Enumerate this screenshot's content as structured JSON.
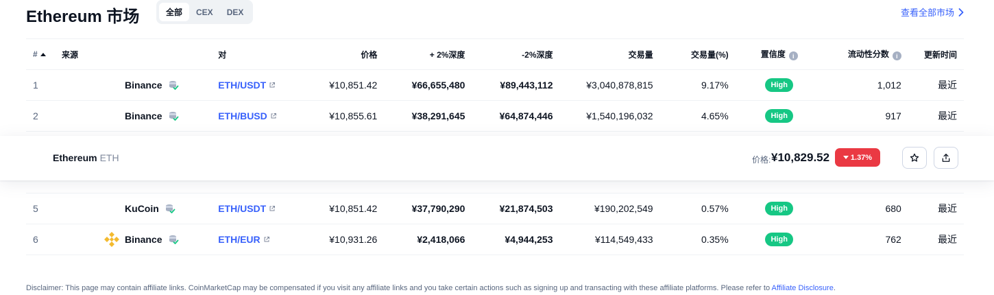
{
  "header": {
    "title": "Ethereum 市场",
    "filters": [
      "全部",
      "CEX",
      "DEX"
    ],
    "view_all": "查看全部市场"
  },
  "table": {
    "columns": {
      "rank": "#",
      "source": "来源",
      "pair": "对",
      "price": "价格",
      "plus_depth": "+ 2%深度",
      "minus_depth": "-2%深度",
      "volume": "交易量",
      "volume_pct": "交易量(%)",
      "confidence": "置信度",
      "liquidity": "流动性分数",
      "updated": "更新时间"
    },
    "rows": [
      {
        "rank": "1",
        "source": "Binance",
        "pair": "ETH/USDT",
        "price": "¥10,851.42",
        "plus_depth": "¥66,655,480",
        "minus_depth": "¥89,443,112",
        "volume": "¥3,040,878,815",
        "volume_pct": "9.17%",
        "confidence": "High",
        "liquidity": "1,012",
        "updated": "最近",
        "logo": "none"
      },
      {
        "rank": "2",
        "source": "Binance",
        "pair": "ETH/BUSD",
        "price": "¥10,855.61",
        "plus_depth": "¥38,291,645",
        "minus_depth": "¥64,874,446",
        "volume": "¥1,540,196,032",
        "volume_pct": "4.65%",
        "confidence": "High",
        "liquidity": "917",
        "updated": "最近",
        "logo": "none"
      },
      {
        "rank": "5",
        "source": "KuCoin",
        "pair": "ETH/USDT",
        "price": "¥10,851.42",
        "plus_depth": "¥37,790,290",
        "minus_depth": "¥21,874,503",
        "volume": "¥190,202,549",
        "volume_pct": "0.57%",
        "confidence": "High",
        "liquidity": "680",
        "updated": "最近",
        "logo": "none"
      },
      {
        "rank": "6",
        "source": "Binance",
        "pair": "ETH/EUR",
        "price": "¥10,931.26",
        "plus_depth": "¥2,418,066",
        "minus_depth": "¥4,944,253",
        "volume": "¥114,549,433",
        "volume_pct": "0.35%",
        "confidence": "High",
        "liquidity": "762",
        "updated": "最近",
        "logo": "binance-logo-icon"
      }
    ]
  },
  "sticky": {
    "name": "Ethereum",
    "symbol": "ETH",
    "price_label": "价格:",
    "price": "¥10,829.52",
    "change": "1.37%",
    "change_color": "#ea3943"
  },
  "disclaimer": {
    "text": "Disclaimer: This page may contain affiliate links. CoinMarketCap may be compensated if you visit any affiliate links and you take certain actions such as signing up and transacting with these affiliate platforms. Please refer to ",
    "link": "Affiliate Disclosure",
    "end": "."
  },
  "colors": {
    "accent": "#3861fb",
    "high_badge": "#16c784",
    "binance": "#f3ba2f"
  }
}
